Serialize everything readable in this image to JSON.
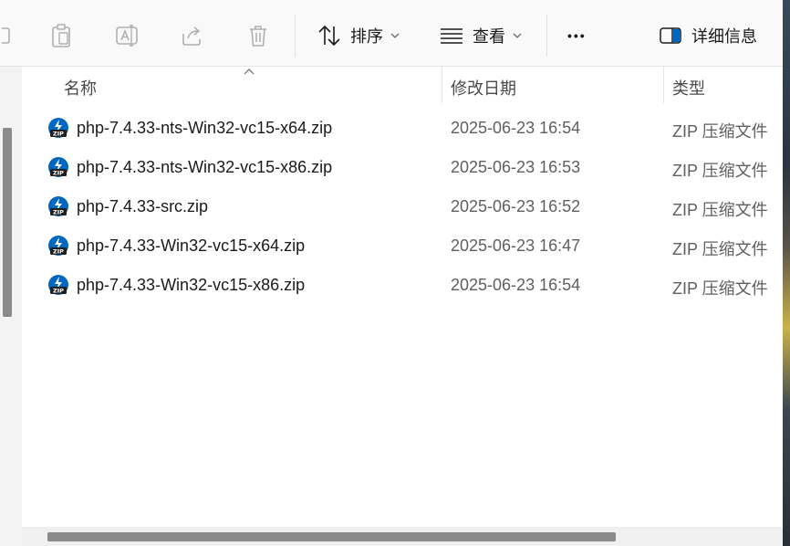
{
  "toolbar": {
    "sort_label": "排序",
    "view_label": "查看",
    "more_label": "•••",
    "details_label": "详细信息"
  },
  "columns": {
    "name": "名称",
    "date": "修改日期",
    "type": "类型"
  },
  "files": [
    {
      "name": "php-7.4.33-nts-Win32-vc15-x64.zip",
      "date": "2025-06-23 16:54",
      "type": "ZIP 压缩文件"
    },
    {
      "name": "php-7.4.33-nts-Win32-vc15-x86.zip",
      "date": "2025-06-23 16:53",
      "type": "ZIP 压缩文件"
    },
    {
      "name": "php-7.4.33-src.zip",
      "date": "2025-06-23 16:52",
      "type": "ZIP 压缩文件"
    },
    {
      "name": "php-7.4.33-Win32-vc15-x64.zip",
      "date": "2025-06-23 16:47",
      "type": "ZIP 压缩文件"
    },
    {
      "name": "php-7.4.33-Win32-vc15-x86.zip",
      "date": "2025-06-23 16:54",
      "type": "ZIP 压缩文件"
    }
  ],
  "colors": {
    "accent": "#0067c0",
    "icon_disabled": "#b0b0b0"
  }
}
